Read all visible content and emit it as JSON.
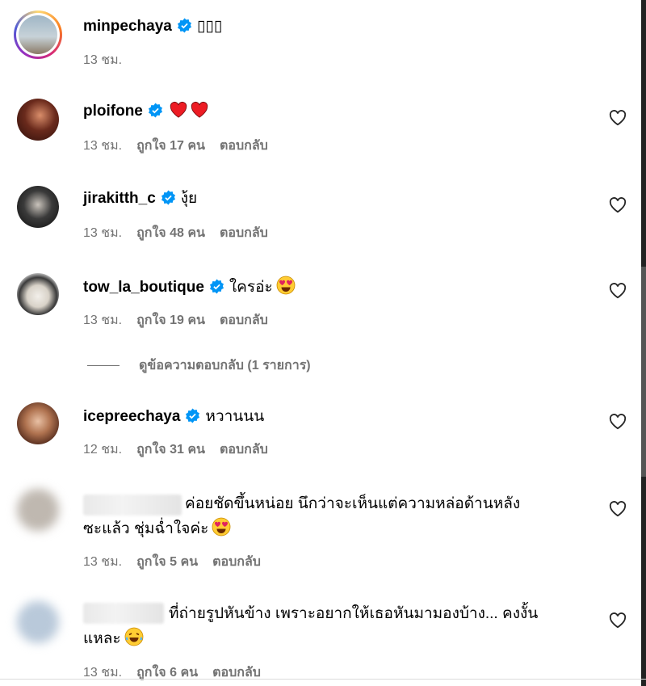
{
  "caption": {
    "username": "minpechaya",
    "text": "▯▯▯",
    "time": "13 ชม."
  },
  "comments": [
    {
      "username": "ploifone",
      "text": "",
      "hearts": 2,
      "time": "13 ชม.",
      "likes": "ถูกใจ 17 คน",
      "reply": "ตอบกลับ"
    },
    {
      "username": "jirakitth_c",
      "text": "งุ้ย",
      "time": "13 ชม.",
      "likes": "ถูกใจ 48 คน",
      "reply": "ตอบกลับ"
    },
    {
      "username": "tow_la_boutique",
      "text": "ใครอ่ะ",
      "emoji": "heart-eyes",
      "time": "13 ชม.",
      "likes": "ถูกใจ 19 คน",
      "reply": "ตอบกลับ"
    },
    {
      "username": "icepreechaya",
      "text": "หวานนน",
      "time": "12 ชม.",
      "likes": "ถูกใจ 31 คน",
      "reply": "ตอบกลับ"
    },
    {
      "username": "",
      "text": "ค่อยชัดขึ้นหน่อย นึกว่าจะเห็นแต่ความหล่อด้านหลัง",
      "text2": "ซะแล้ว ชุ่มฉ่ำใจค่ะ",
      "emoji": "heart-eyes",
      "time": "13 ชม.",
      "likes": "ถูกใจ 5 คน",
      "reply": "ตอบกลับ"
    },
    {
      "username": "",
      "text": "ที่ถ่ายรูปหันข้าง เพราะอยากให้เธอหันมามองบ้าง... คงงั้น",
      "text2": "แหละ",
      "emoji": "tears-of-joy",
      "time": "13 ชม.",
      "likes": "ถูกใจ 6 คน",
      "reply": "ตอบกลับ"
    }
  ],
  "thread": {
    "label": "ดูข้อความตอบกลับ (1 รายการ)"
  },
  "colors": {
    "verified": "#0095f6",
    "meta": "#737373",
    "heart": "#ed1c24"
  },
  "icons": {
    "verified": "verified-badge-icon",
    "like": "heart-outline-icon"
  }
}
